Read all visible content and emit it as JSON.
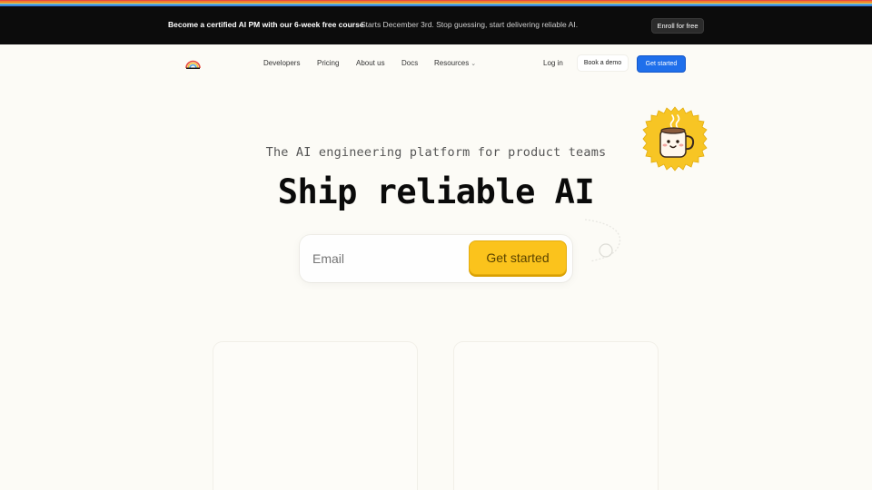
{
  "colors": {
    "rainbow": [
      "#e8493f",
      "#f07f2e",
      "#f5c33b",
      "#4fa3e0",
      "#2f6fd6"
    ],
    "announce_bg": "#0c0c0c",
    "accent_blue": "#1f6feb",
    "cta_yellow": "#fbc31c",
    "page_bg": "#fcfbf6"
  },
  "announcement": {
    "headline": "Become a certified AI PM with our 6-week free course",
    "detail": "Starts December 3rd. Stop guessing, start delivering reliable AI.",
    "button_label": "Enroll for free"
  },
  "nav": {
    "logo_icon": "rainbow-logo-icon",
    "items": [
      {
        "label": "Developers"
      },
      {
        "label": "Pricing"
      },
      {
        "label": "About us"
      },
      {
        "label": "Docs"
      },
      {
        "label": "Resources",
        "icon": "chevron-down-icon"
      }
    ],
    "login_label": "Log in",
    "demo_label": "Book a demo",
    "get_started_label": "Get started"
  },
  "hero": {
    "tagline": "The AI engineering platform for product teams",
    "headline": "Ship reliable AI",
    "email_placeholder": "Email",
    "cta_label": "Get started",
    "badge_icon": "coffee-mug-badge-icon"
  }
}
